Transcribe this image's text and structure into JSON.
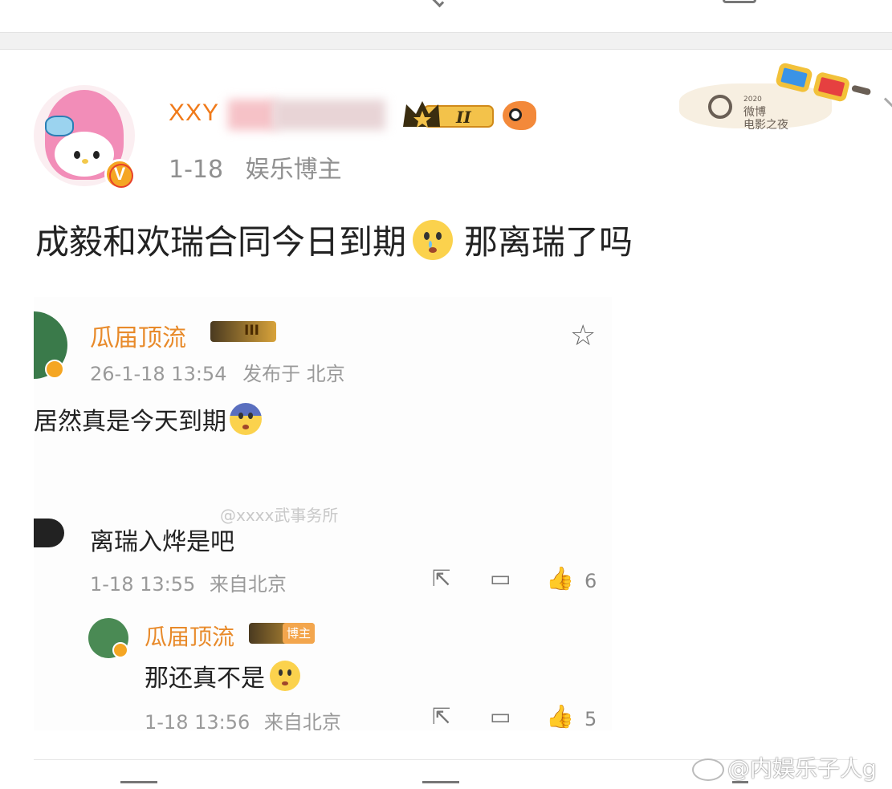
{
  "post": {
    "username": "XXY",
    "date": "1-18",
    "role": "娱乐博主",
    "level_badge": "II",
    "text": "成毅和欢瑞合同今日到期",
    "text_after_emoji": "那离瑞了吗",
    "card_deco_text_1": "2020",
    "card_deco_text_2": "微博",
    "card_deco_text_3": "电影之夜"
  },
  "screenshot": {
    "quoted_name": "瓜届顶流",
    "quoted_level": "III",
    "quoted_time": "26-1-18 13:54",
    "quoted_location": "发布于 北京",
    "quoted_text": "居然真是今天到期",
    "watermark": "@xxxx武事务所",
    "comment_text": "离瑞入烨是吧",
    "comment_time": "1-18 13:55",
    "comment_location": "来自北京",
    "comment_likes": "6",
    "reply_name": "瓜届顶流",
    "reply_role_tag": "博主",
    "reply_text": "那还真不是",
    "reply_time": "1-18 13:56",
    "reply_location": "来自北京",
    "reply_likes": "5"
  },
  "footer": {
    "watermark": "@内娱乐子人g"
  },
  "icons": {
    "verified": "v-verified-icon",
    "star": "star-icon",
    "share": "share-icon",
    "comment": "comment-icon",
    "like": "like-icon"
  },
  "colors": {
    "username": "#f07a1a",
    "quoted_name": "#e88a2a",
    "verified": "#f5a623"
  }
}
